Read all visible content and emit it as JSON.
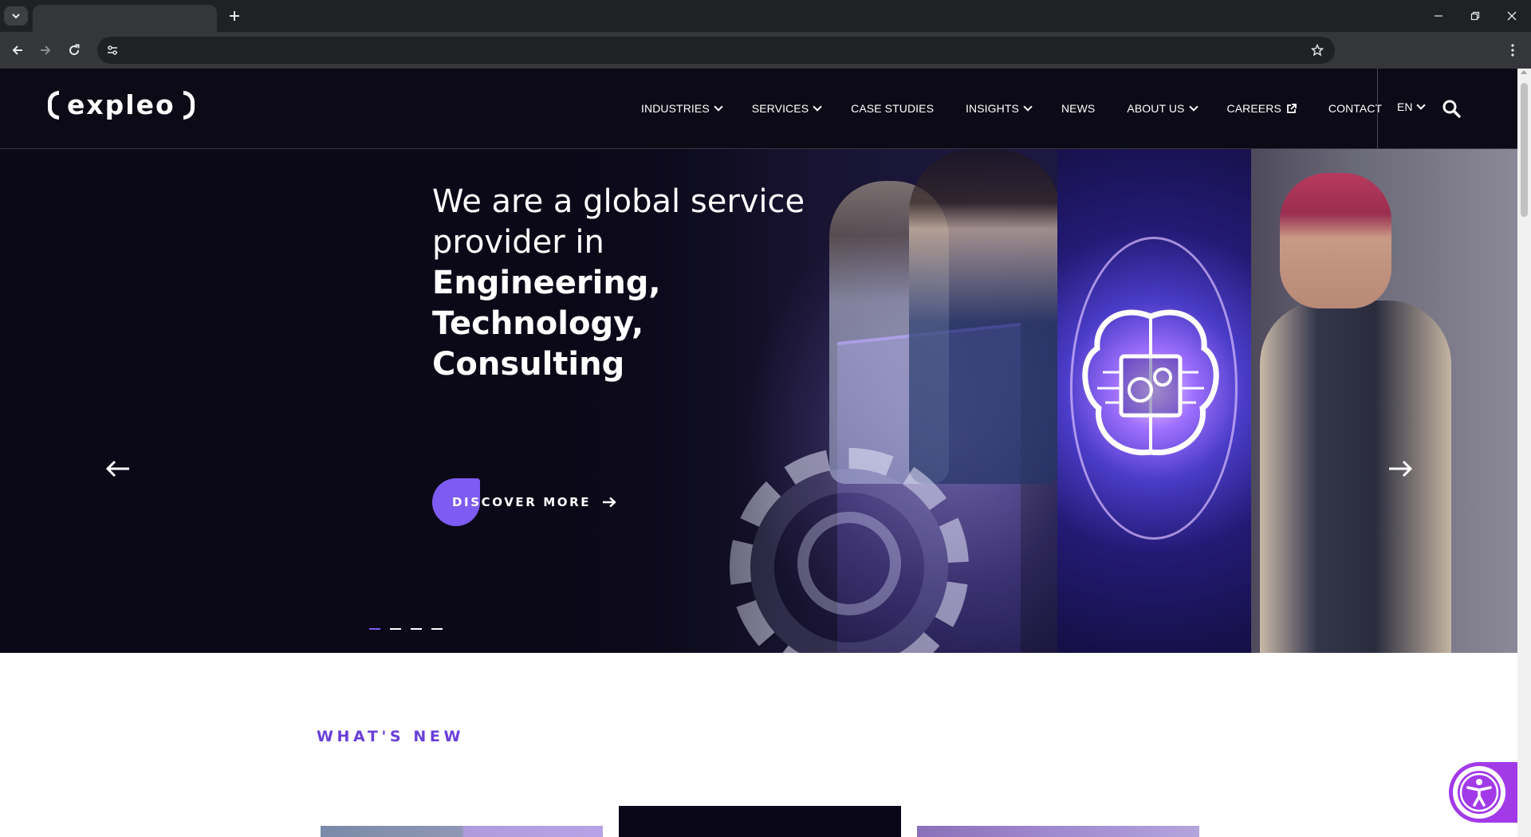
{
  "browser": {
    "url": "",
    "colors": {
      "chrome_bg": "#202124",
      "toolbar_bg": "#35363a"
    }
  },
  "header": {
    "logo": "expleo",
    "nav": [
      {
        "label": "INDUSTRIES",
        "dropdown": true
      },
      {
        "label": "SERVICES",
        "dropdown": true
      },
      {
        "label": "CASE STUDIES",
        "dropdown": false
      },
      {
        "label": "INSIGHTS",
        "dropdown": true
      },
      {
        "label": "NEWS",
        "dropdown": false
      },
      {
        "label": "ABOUT US",
        "dropdown": true
      },
      {
        "label": "CAREERS",
        "dropdown": false,
        "external": true
      },
      {
        "label": "CONTACT",
        "dropdown": false
      }
    ],
    "language": "EN",
    "icons": {
      "search": "search-icon",
      "external": "external-link-icon",
      "dropdown": "chevron-down-icon"
    }
  },
  "hero": {
    "line1": "We are a global service",
    "line2": "provider in",
    "bold1": "Engineering,",
    "bold2": "Technology,",
    "bold3": "Consulting",
    "cta_label": "DISCOVER MORE",
    "slide_count": 4,
    "active_slide": 1,
    "accent": "#7e5bf2"
  },
  "whats_new": {
    "title": "WHAT'S NEW",
    "title_color": "#6a3fd8"
  },
  "accessibility": {
    "icon": "accessibility-icon",
    "color": "#a23ae8"
  }
}
